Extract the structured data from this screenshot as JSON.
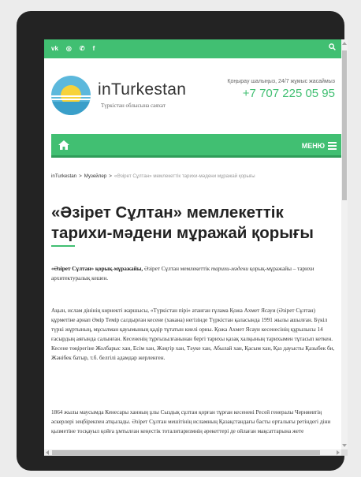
{
  "colors": {
    "accent": "#41bf72",
    "accent_dark": "#2f9d59",
    "bezel": "#232323",
    "background": "#ececec"
  },
  "topbar": {
    "social": [
      {
        "icon": "vk-icon",
        "label": "vk"
      },
      {
        "icon": "instagram-icon",
        "label": "◎"
      },
      {
        "icon": "whatsapp-icon",
        "label": "✆"
      },
      {
        "icon": "facebook-icon",
        "label": "f"
      }
    ],
    "search_icon": "search-icon"
  },
  "header": {
    "site_name": "inTurkestan",
    "tagline": "Түркістан облысына саяхат",
    "call_label": "Қоңырау шалыңыз, 24/7 жұмыс жасаймыз",
    "phone": "+7 707 225 05 95"
  },
  "nav": {
    "home_icon": "home-icon",
    "menu_label": "МЕНЮ"
  },
  "breadcrumb": {
    "items": [
      "inTurkestan",
      "Музейлер",
      "«Әзірет Сұлтан» мемлекеттік тарихи-мәдени мұражай қорығы"
    ],
    "separator": ">"
  },
  "article": {
    "title": "«Әзірет Сұлтан» мемлекеттік тарихи-мәдени мұражай қорығы",
    "p1_bold": "«Әзірет Сұлтан» қорық-мұражайы,",
    "p1_text_a": " Әзірет Сұлтан мемлекеттік ",
    "p1_italic": "тарихи-мәдени",
    "p1_text_b": " қорық-мұражайы – тарихи архитектуралық кешен.",
    "p2": "Ақын, ислам дінінің көрнекті жаршысы, «Түркістан пірі» атанған ғұлама Қожа Ахмет Ясауи (Әзірет Сұлтан) құрметіне арнап Әмір Темір салдырған кесене (хакана) негізінде Түркістан қаласында 1991 жылы ашылған. Бүкіл түркі жұртының, мұсылман қауымының қадір тұтатын киелі орны. Қожа Ахмет Ясауи кесенесінің құрылысы 14 ғасырдың аяғында салынған. Кесененің тұрғызылғанынан бергі тарихы қазақ халқының тарихымен тұтасып кеткен. Кесене төңірегіне Жолбарыс хан, Есім хан, Жәңгір хан, Тәуке хан, Абылай хан, Қасым хан, Қаз дауысты Қазыбек би, Жәнібек батыр, т.б. белгілі адамдар жерленген.",
    "p3": "1864 жылы маусымда Кенесары ханның ұлы Сыздық сұлтан қорған тұрған кесенені Ресей генералы Черняевтің әскерлері зеңбірекпен атқылады. Әзірет Сұлтан мешітінің исламның Қазақстандағы басты орталығы ретіндегі діни қызметіне тосқауыл қойға ұмтылған кеңестік тоталитаризмнің әрекеттері де ойлаған мақсаттарына жете"
  }
}
